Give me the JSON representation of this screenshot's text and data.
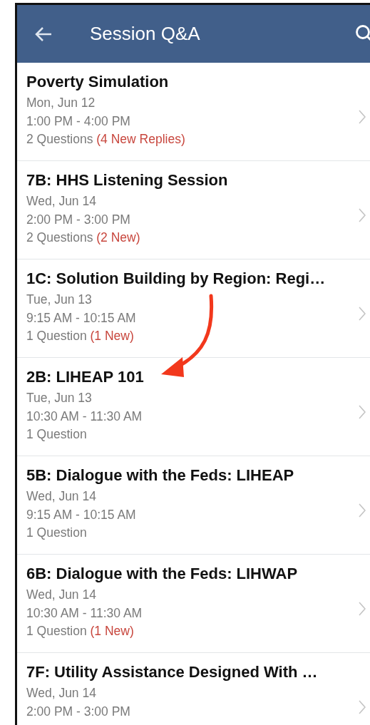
{
  "header": {
    "title": "Session Q&A"
  },
  "sessions": [
    {
      "title": "Poverty Simulation",
      "date": "Mon, Jun 12",
      "time": "1:00 PM - 4:00 PM",
      "questions": "2 Questions",
      "new_label": "(4 New Replies)"
    },
    {
      "title": "7B: HHS Listening Session",
      "date": "Wed, Jun 14",
      "time": "2:00 PM - 3:00 PM",
      "questions": "2 Questions",
      "new_label": "(2 New)"
    },
    {
      "title": "1C: Solution Building by Region: Regi…",
      "date": "Tue, Jun 13",
      "time": "9:15 AM - 10:15 AM",
      "questions": "1 Question",
      "new_label": "(1 New)"
    },
    {
      "title": "2B: LIHEAP 101",
      "date": "Tue, Jun 13",
      "time": "10:30 AM - 11:30 AM",
      "questions": "1 Question"
    },
    {
      "title": "5B: Dialogue with the Feds: LIHEAP",
      "date": "Wed, Jun 14",
      "time": "9:15 AM - 10:15 AM",
      "questions": "1 Question"
    },
    {
      "title": "6B: Dialogue with the Feds: LIHWAP",
      "date": "Wed, Jun 14",
      "time": "10:30 AM - 11:30 AM",
      "questions": "1 Question",
      "new_label": "(1 New)"
    },
    {
      "title": "7F: Utility Assistance Designed With …",
      "date": "Wed, Jun 14",
      "time": "2:00 PM - 3:00 PM"
    }
  ]
}
